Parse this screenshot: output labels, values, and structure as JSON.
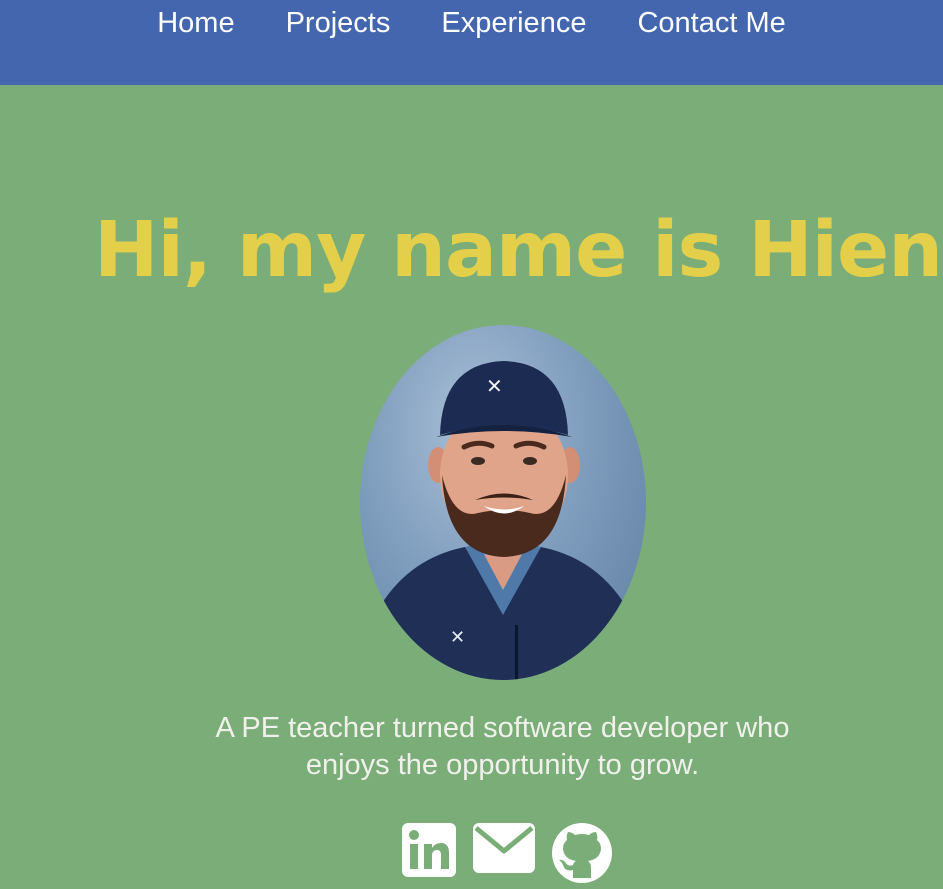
{
  "nav": {
    "items": [
      {
        "label": "Home"
      },
      {
        "label": "Projects"
      },
      {
        "label": "Experience"
      },
      {
        "label": "Contact Me"
      }
    ]
  },
  "hero": {
    "greeting": "Hi, my name is Hien",
    "tagline_line1": "A PE teacher turned software developer who",
    "tagline_line2": "enjoys the opportunity to grow."
  },
  "socials": [
    {
      "icon": "linkedin-icon"
    },
    {
      "icon": "mail-icon"
    },
    {
      "icon": "github-icon"
    }
  ],
  "colors": {
    "nav_background": "#4466ae",
    "page_background": "#7aad77",
    "greeting_text": "#e4cf4a",
    "body_text": "#f1f1ec"
  }
}
